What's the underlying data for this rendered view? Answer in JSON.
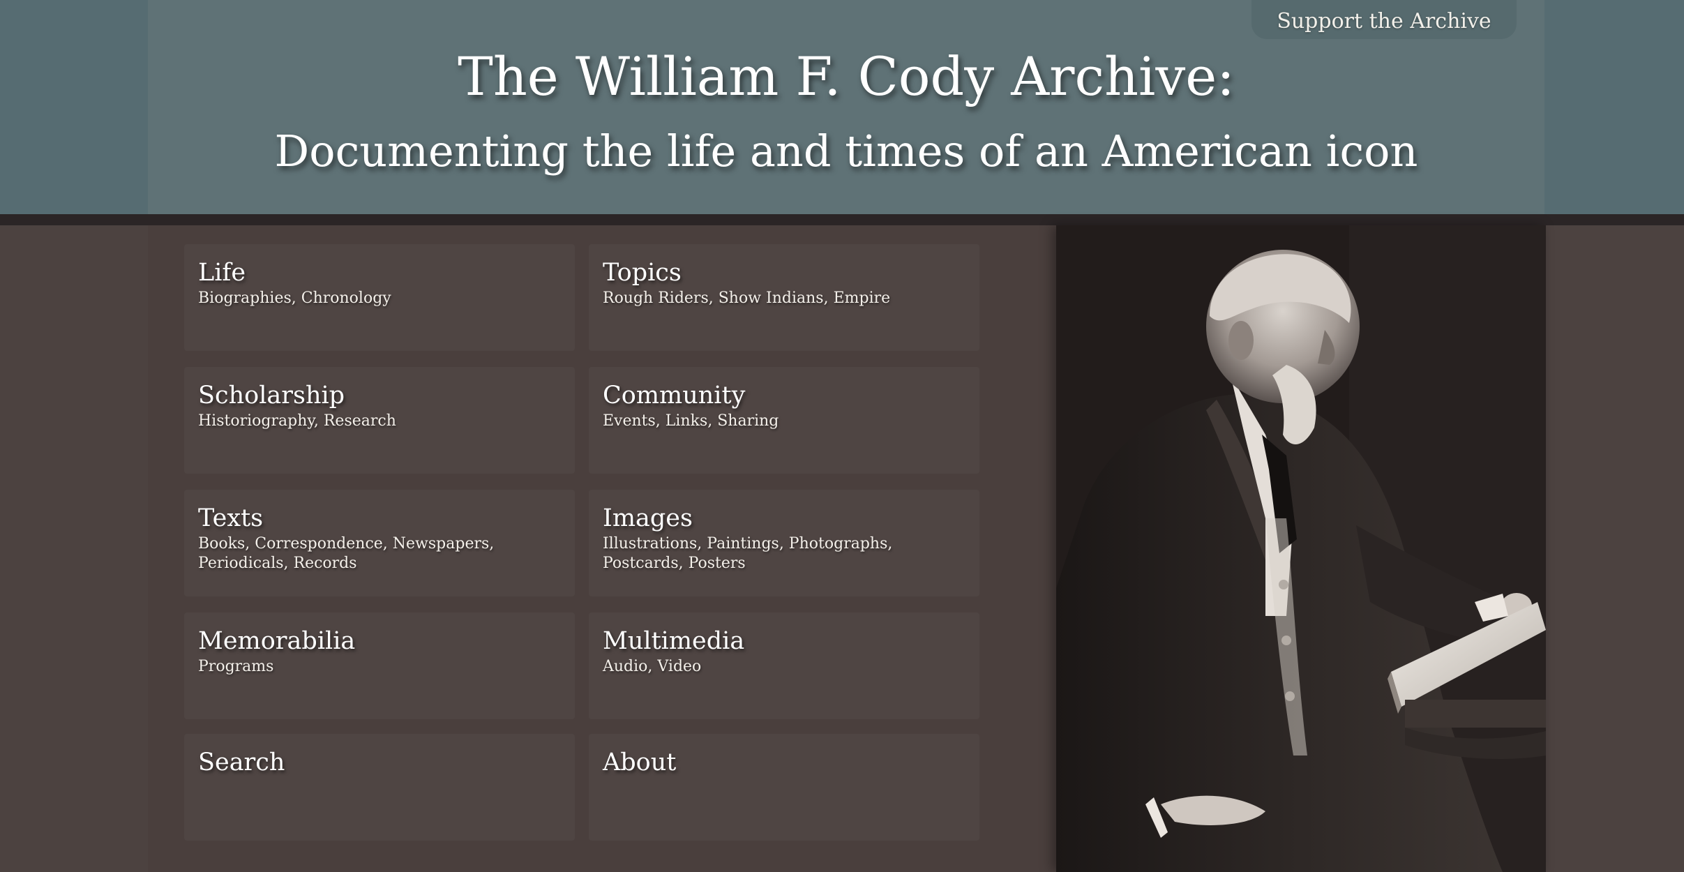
{
  "header": {
    "support_label": "Support the Archive",
    "title": "The William F. Cody Archive:",
    "subtitle": "Documenting the life and times of an American icon"
  },
  "nav": {
    "cards": [
      {
        "title": "Life",
        "desc": "Biographies, Chronology"
      },
      {
        "title": "Topics",
        "desc": "Rough Riders, Show Indians, Empire"
      },
      {
        "title": "Scholarship",
        "desc": "Historiography, Research"
      },
      {
        "title": "Community",
        "desc": "Events, Links, Sharing"
      },
      {
        "title": "Texts",
        "desc": "Books, Correspondence, Newspapers, Periodicals, Records"
      },
      {
        "title": "Images",
        "desc": "Illustrations, Paintings, Photographs, Postcards, Posters"
      },
      {
        "title": "Memorabilia",
        "desc": "Programs"
      },
      {
        "title": "Multimedia",
        "desc": "Audio, Video"
      },
      {
        "title": "Search",
        "desc": ""
      },
      {
        "title": "About",
        "desc": ""
      }
    ]
  },
  "colors": {
    "header_bg": "#5f7276",
    "main_bg": "#4a3f3d",
    "card_bg": "#4f4543",
    "text": "#ffffff"
  }
}
